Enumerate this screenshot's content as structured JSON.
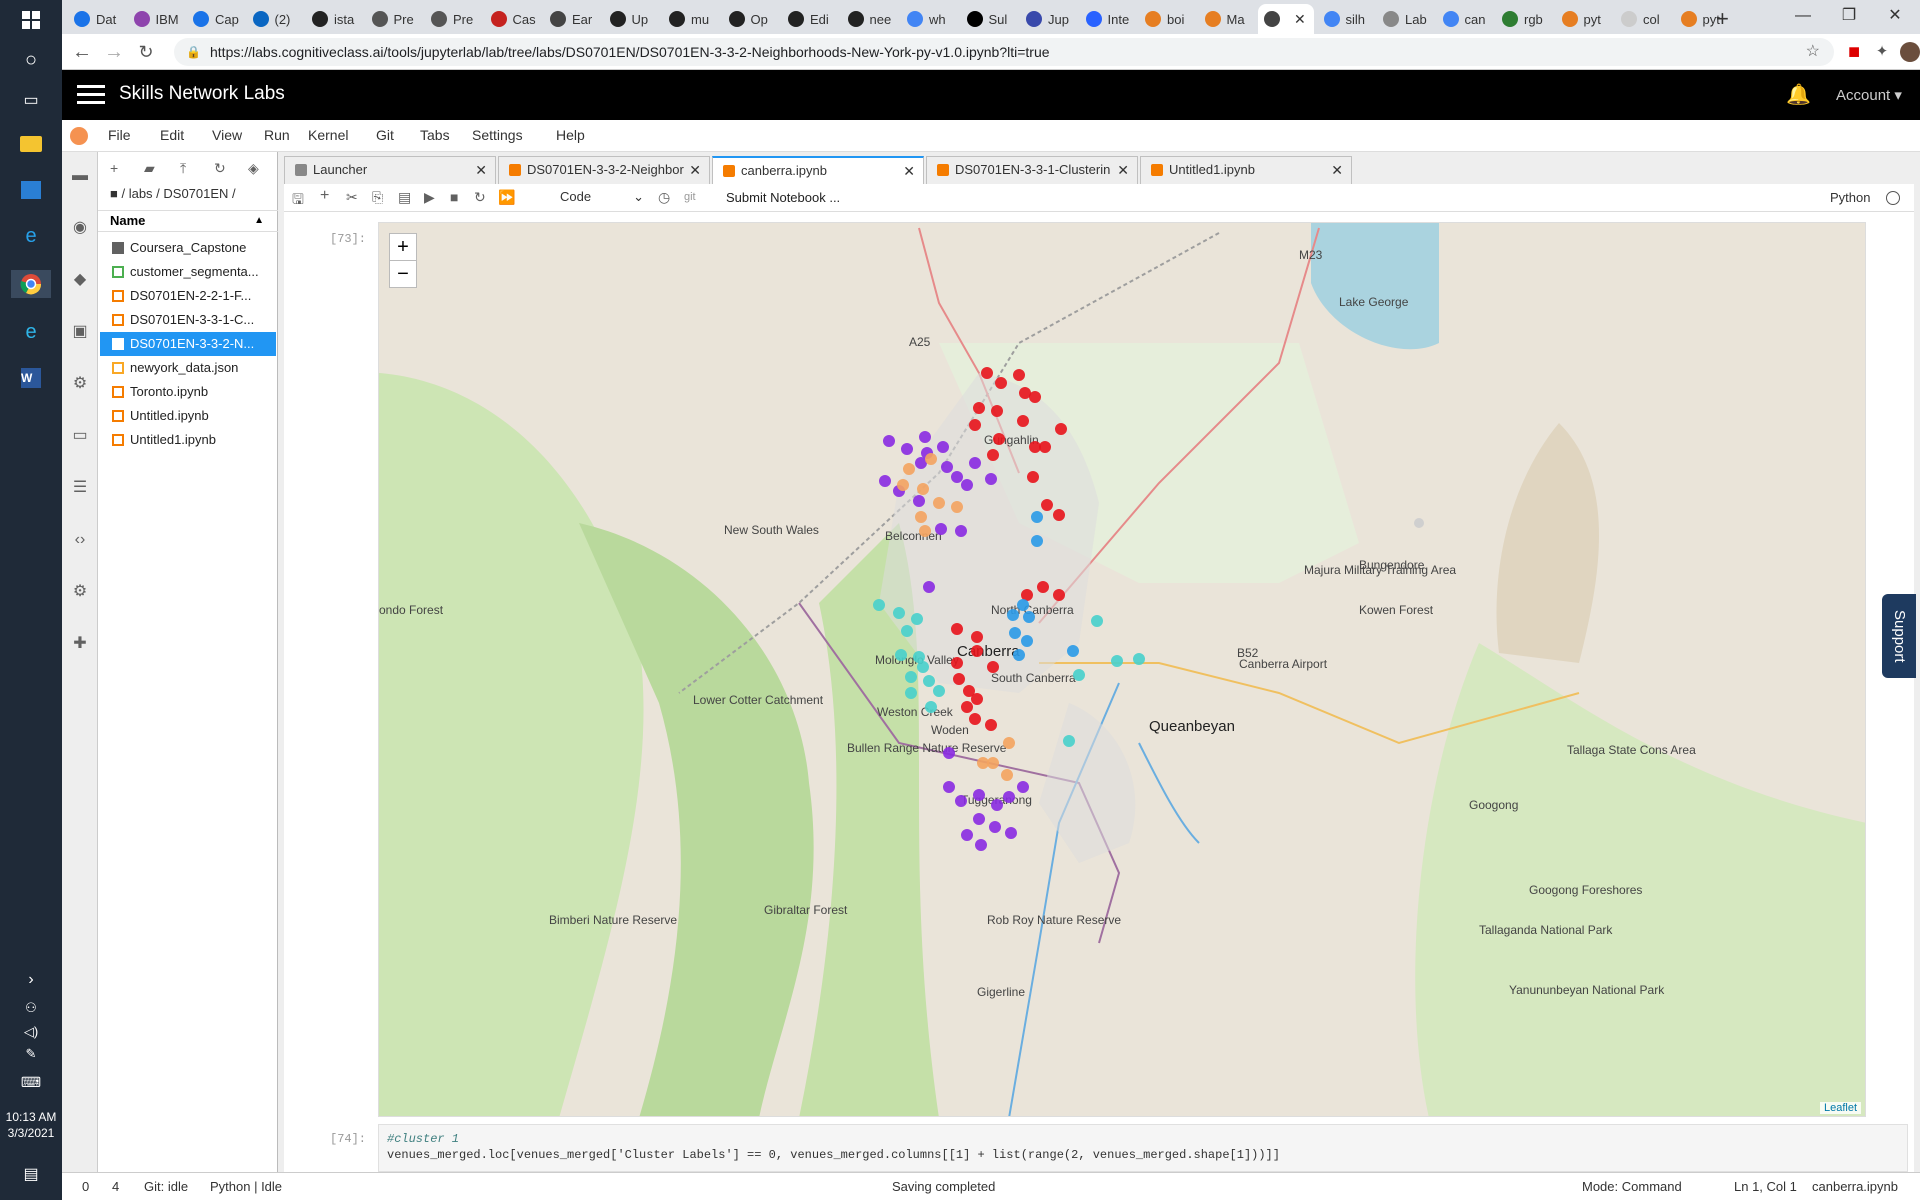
{
  "taskbar": {
    "time": "10:13 AM",
    "date": "3/3/2021"
  },
  "browser": {
    "tabs": [
      {
        "label": "Dat",
        "color": "#1a73e8"
      },
      {
        "label": "IBM",
        "color": "#8e44ad"
      },
      {
        "label": "Cap",
        "color": "#1a73e8"
      },
      {
        "label": "(2)",
        "color": "#0a66c2"
      },
      {
        "label": "ista",
        "color": "#222"
      },
      {
        "label": "Pre",
        "color": "#555"
      },
      {
        "label": "Pre",
        "color": "#555"
      },
      {
        "label": "Cas",
        "color": "#c5221f"
      },
      {
        "label": "Ear",
        "color": "#444"
      },
      {
        "label": "Up",
        "color": "#222"
      },
      {
        "label": "mu",
        "color": "#222"
      },
      {
        "label": "Op",
        "color": "#222"
      },
      {
        "label": "Edi",
        "color": "#222"
      },
      {
        "label": "nee",
        "color": "#222"
      },
      {
        "label": "wh",
        "color": "#4285f4"
      },
      {
        "label": "Sul",
        "color": "#000"
      },
      {
        "label": "Jup",
        "color": "#3949ab"
      },
      {
        "label": "Inte",
        "color": "#2962ff"
      },
      {
        "label": "boi",
        "color": "#e67e22"
      },
      {
        "label": "Ma",
        "color": "#e67e22"
      },
      {
        "label": "",
        "color": "#444"
      },
      {
        "label": "silh",
        "color": "#4285f4"
      },
      {
        "label": "Lab",
        "color": "#888"
      },
      {
        "label": "can",
        "color": "#4285f4"
      },
      {
        "label": "rgb",
        "color": "#2e7d32"
      },
      {
        "label": "pyt",
        "color": "#e67e22"
      },
      {
        "label": "col",
        "color": "#ccc"
      },
      {
        "label": "pyt",
        "color": "#e67e22"
      }
    ],
    "url": "https://labs.cognitiveclass.ai/tools/jupyterlab/lab/tree/labs/DS0701EN/DS0701EN-3-3-2-Neighborhoods-New-York-py-v1.0.ipynb?lti=true"
  },
  "header": {
    "title": "Skills Network Labs",
    "account": "Account"
  },
  "menu": [
    "File",
    "Edit",
    "View",
    "Run",
    "Kernel",
    "Git",
    "Tabs",
    "Settings",
    "Help"
  ],
  "filebrowser": {
    "breadcrumb": "/ labs / DS0701EN /",
    "column": "Name",
    "items": [
      {
        "name": "Coursera_Capstone",
        "type": "folder"
      },
      {
        "name": "customer_segmenta...",
        "type": "csv"
      },
      {
        "name": "DS0701EN-2-2-1-F...",
        "type": "notebook"
      },
      {
        "name": "DS0701EN-3-3-1-C...",
        "type": "notebook"
      },
      {
        "name": "DS0701EN-3-3-2-N...",
        "type": "notebook",
        "selected": true
      },
      {
        "name": "newyork_data.json",
        "type": "json"
      },
      {
        "name": "Toronto.ipynb",
        "type": "notebook"
      },
      {
        "name": "Untitled.ipynb",
        "type": "notebook"
      },
      {
        "name": "Untitled1.ipynb",
        "type": "notebook"
      }
    ]
  },
  "notebook": {
    "tabs": [
      "Launcher",
      "DS0701EN-3-3-2-Neighbor",
      "canberra.ipynb",
      "DS0701EN-3-3-1-Clusterin",
      "Untitled1.ipynb"
    ],
    "active_tab": 2,
    "celltype": "Code",
    "git": "git",
    "submit": "Submit Notebook ...",
    "kernel": "Python",
    "prompt1": "[73]:",
    "prompt2": "[74]:",
    "code_line1": "#cluster 1",
    "code_line2": "venues_merged.loc[venues_merged['Cluster Labels'] == 0, venues_merged.columns[[1] + list(range(2, venues_merged.shape[1]))]]"
  },
  "map": {
    "zoom_in": "+",
    "zoom_out": "−",
    "attribution": "Leaflet",
    "labels": [
      "Gungahlin",
      "Belconnen",
      "North Canberra",
      "Canberra",
      "Molonglo Valley",
      "South Canberra",
      "Weston Creek",
      "Woden",
      "Tuggeranong",
      "Queanbeyan",
      "Bungendore",
      "Lake George",
      "Kowen Forest",
      "Majura Military Training Area",
      "Canberra Airport",
      "Lower Cotter Catchment",
      "Bullen Range Nature Reserve",
      "Googong",
      "Googong Foreshores",
      "Gibraltar Forest",
      "Bimberi Nature Reserve",
      "Rob Roy Nature Reserve",
      "Tallaganda National Park",
      "Yanununbeyan National Park",
      "Gigerline",
      "New South Wales",
      "ondo Forest",
      "A25",
      "M23",
      "B52",
      "Tallaga State Cons Area"
    ],
    "clusters": [
      {
        "name": "red",
        "color": "#e8141c"
      },
      {
        "name": "purple",
        "color": "#8a2be2"
      },
      {
        "name": "orange",
        "color": "#f4a460"
      },
      {
        "name": "blue",
        "color": "#2b9be8"
      },
      {
        "name": "cyan",
        "color": "#48d1cc"
      }
    ]
  },
  "support": "Support",
  "status": {
    "left_a": "0",
    "left_b": "4",
    "git": "Git: idle",
    "kernel": "Python | Idle",
    "saving": "Saving completed",
    "mode": "Mode: Command",
    "pos": "Ln 1, Col 1",
    "file": "canberra.ipynb"
  }
}
